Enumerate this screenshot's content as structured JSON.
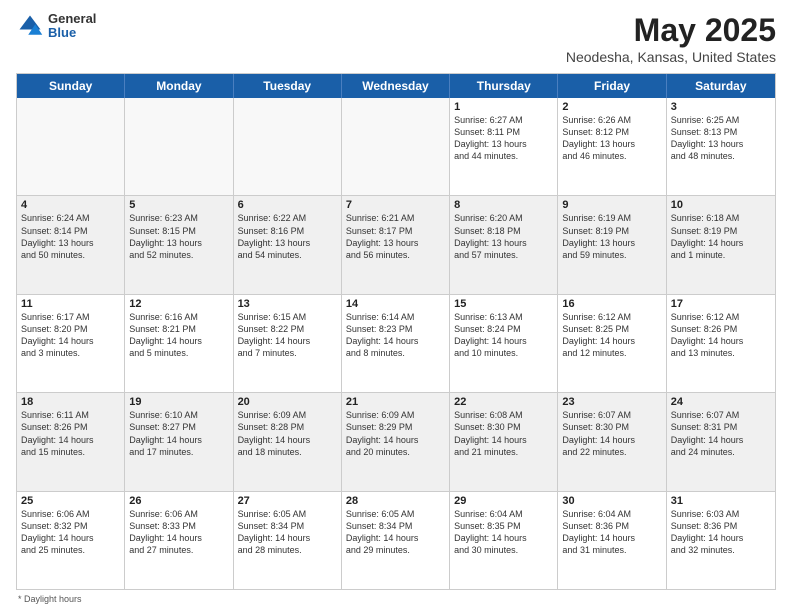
{
  "header": {
    "logo": {
      "general": "General",
      "blue": "Blue"
    },
    "title": "May 2025",
    "subtitle": "Neodesha, Kansas, United States"
  },
  "calendar": {
    "days": [
      "Sunday",
      "Monday",
      "Tuesday",
      "Wednesday",
      "Thursday",
      "Friday",
      "Saturday"
    ],
    "weeks": [
      [
        {
          "day": "",
          "content": ""
        },
        {
          "day": "",
          "content": ""
        },
        {
          "day": "",
          "content": ""
        },
        {
          "day": "",
          "content": ""
        },
        {
          "day": "1",
          "content": "Sunrise: 6:27 AM\nSunset: 8:11 PM\nDaylight: 13 hours\nand 44 minutes."
        },
        {
          "day": "2",
          "content": "Sunrise: 6:26 AM\nSunset: 8:12 PM\nDaylight: 13 hours\nand 46 minutes."
        },
        {
          "day": "3",
          "content": "Sunrise: 6:25 AM\nSunset: 8:13 PM\nDaylight: 13 hours\nand 48 minutes."
        }
      ],
      [
        {
          "day": "4",
          "content": "Sunrise: 6:24 AM\nSunset: 8:14 PM\nDaylight: 13 hours\nand 50 minutes."
        },
        {
          "day": "5",
          "content": "Sunrise: 6:23 AM\nSunset: 8:15 PM\nDaylight: 13 hours\nand 52 minutes."
        },
        {
          "day": "6",
          "content": "Sunrise: 6:22 AM\nSunset: 8:16 PM\nDaylight: 13 hours\nand 54 minutes."
        },
        {
          "day": "7",
          "content": "Sunrise: 6:21 AM\nSunset: 8:17 PM\nDaylight: 13 hours\nand 56 minutes."
        },
        {
          "day": "8",
          "content": "Sunrise: 6:20 AM\nSunset: 8:18 PM\nDaylight: 13 hours\nand 57 minutes."
        },
        {
          "day": "9",
          "content": "Sunrise: 6:19 AM\nSunset: 8:19 PM\nDaylight: 13 hours\nand 59 minutes."
        },
        {
          "day": "10",
          "content": "Sunrise: 6:18 AM\nSunset: 8:19 PM\nDaylight: 14 hours\nand 1 minute."
        }
      ],
      [
        {
          "day": "11",
          "content": "Sunrise: 6:17 AM\nSunset: 8:20 PM\nDaylight: 14 hours\nand 3 minutes."
        },
        {
          "day": "12",
          "content": "Sunrise: 6:16 AM\nSunset: 8:21 PM\nDaylight: 14 hours\nand 5 minutes."
        },
        {
          "day": "13",
          "content": "Sunrise: 6:15 AM\nSunset: 8:22 PM\nDaylight: 14 hours\nand 7 minutes."
        },
        {
          "day": "14",
          "content": "Sunrise: 6:14 AM\nSunset: 8:23 PM\nDaylight: 14 hours\nand 8 minutes."
        },
        {
          "day": "15",
          "content": "Sunrise: 6:13 AM\nSunset: 8:24 PM\nDaylight: 14 hours\nand 10 minutes."
        },
        {
          "day": "16",
          "content": "Sunrise: 6:12 AM\nSunset: 8:25 PM\nDaylight: 14 hours\nand 12 minutes."
        },
        {
          "day": "17",
          "content": "Sunrise: 6:12 AM\nSunset: 8:26 PM\nDaylight: 14 hours\nand 13 minutes."
        }
      ],
      [
        {
          "day": "18",
          "content": "Sunrise: 6:11 AM\nSunset: 8:26 PM\nDaylight: 14 hours\nand 15 minutes."
        },
        {
          "day": "19",
          "content": "Sunrise: 6:10 AM\nSunset: 8:27 PM\nDaylight: 14 hours\nand 17 minutes."
        },
        {
          "day": "20",
          "content": "Sunrise: 6:09 AM\nSunset: 8:28 PM\nDaylight: 14 hours\nand 18 minutes."
        },
        {
          "day": "21",
          "content": "Sunrise: 6:09 AM\nSunset: 8:29 PM\nDaylight: 14 hours\nand 20 minutes."
        },
        {
          "day": "22",
          "content": "Sunrise: 6:08 AM\nSunset: 8:30 PM\nDaylight: 14 hours\nand 21 minutes."
        },
        {
          "day": "23",
          "content": "Sunrise: 6:07 AM\nSunset: 8:30 PM\nDaylight: 14 hours\nand 22 minutes."
        },
        {
          "day": "24",
          "content": "Sunrise: 6:07 AM\nSunset: 8:31 PM\nDaylight: 14 hours\nand 24 minutes."
        }
      ],
      [
        {
          "day": "25",
          "content": "Sunrise: 6:06 AM\nSunset: 8:32 PM\nDaylight: 14 hours\nand 25 minutes."
        },
        {
          "day": "26",
          "content": "Sunrise: 6:06 AM\nSunset: 8:33 PM\nDaylight: 14 hours\nand 27 minutes."
        },
        {
          "day": "27",
          "content": "Sunrise: 6:05 AM\nSunset: 8:34 PM\nDaylight: 14 hours\nand 28 minutes."
        },
        {
          "day": "28",
          "content": "Sunrise: 6:05 AM\nSunset: 8:34 PM\nDaylight: 14 hours\nand 29 minutes."
        },
        {
          "day": "29",
          "content": "Sunrise: 6:04 AM\nSunset: 8:35 PM\nDaylight: 14 hours\nand 30 minutes."
        },
        {
          "day": "30",
          "content": "Sunrise: 6:04 AM\nSunset: 8:36 PM\nDaylight: 14 hours\nand 31 minutes."
        },
        {
          "day": "31",
          "content": "Sunrise: 6:03 AM\nSunset: 8:36 PM\nDaylight: 14 hours\nand 32 minutes."
        }
      ]
    ],
    "footer": "* Daylight hours"
  }
}
